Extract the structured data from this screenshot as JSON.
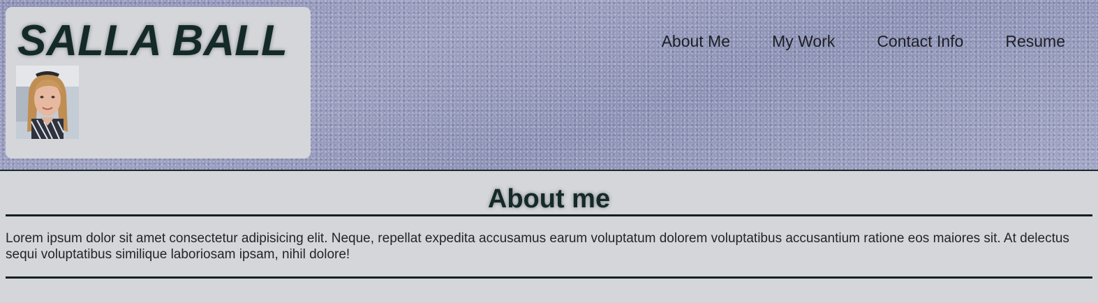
{
  "header": {
    "brand_title": "SALLA BALL",
    "avatar_alt": "profile photo",
    "nav": [
      {
        "label": "About Me"
      },
      {
        "label": "My Work"
      },
      {
        "label": "Contact Info"
      },
      {
        "label": "Resume"
      }
    ]
  },
  "main": {
    "section_title": "About me",
    "paragraph": "Lorem ipsum dolor sit amet consectetur adipisicing elit. Neque, repellat expedita accusamus earum voluptatum dolorem voluptatibus accusantium ratione eos maiores sit. At delectus sequi voluptatibus similique laboriosam ipsam, nihil dolore!"
  },
  "colors": {
    "page_background": "#d5d6d9",
    "header_background": "#8c90b4",
    "title_color": "#142a28",
    "rule_color": "#13201f"
  }
}
